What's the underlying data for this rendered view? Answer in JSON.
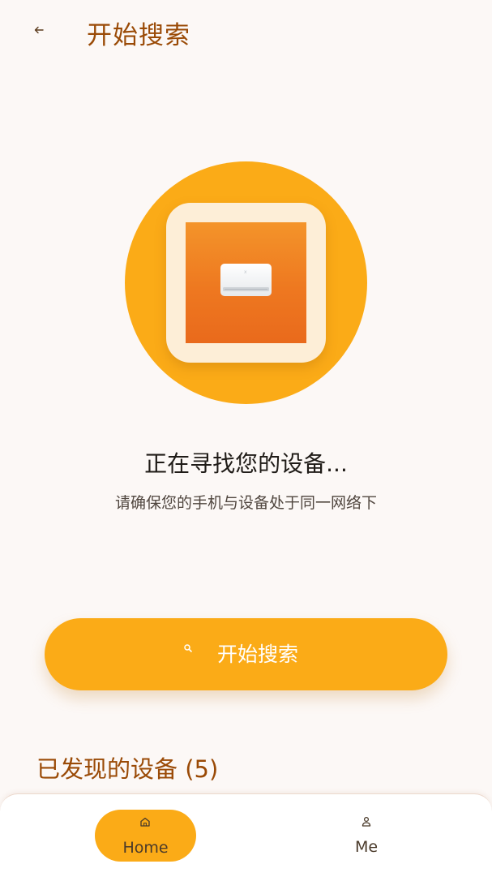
{
  "header": {
    "title": "开始搜索",
    "back_icon": "arrow-left-icon"
  },
  "hero": {
    "device_icon": "air-conditioner-icon",
    "circle_color": "#fbab17"
  },
  "status": {
    "title": "正在寻找您的设备...",
    "subtitle": "请确保您的手机与设备处于同一网络下"
  },
  "search_button": {
    "label": "开始搜索",
    "icon": "search-icon"
  },
  "found": {
    "heading": "已发现的设备 (5)"
  },
  "bottom_nav": {
    "items": [
      {
        "label": "Home",
        "icon": "home-icon",
        "active": true
      },
      {
        "label": "Me",
        "icon": "person-icon",
        "active": false
      }
    ]
  },
  "colors": {
    "accent": "#fbab17",
    "title": "#9a4a06",
    "background": "#fcf8f6"
  }
}
